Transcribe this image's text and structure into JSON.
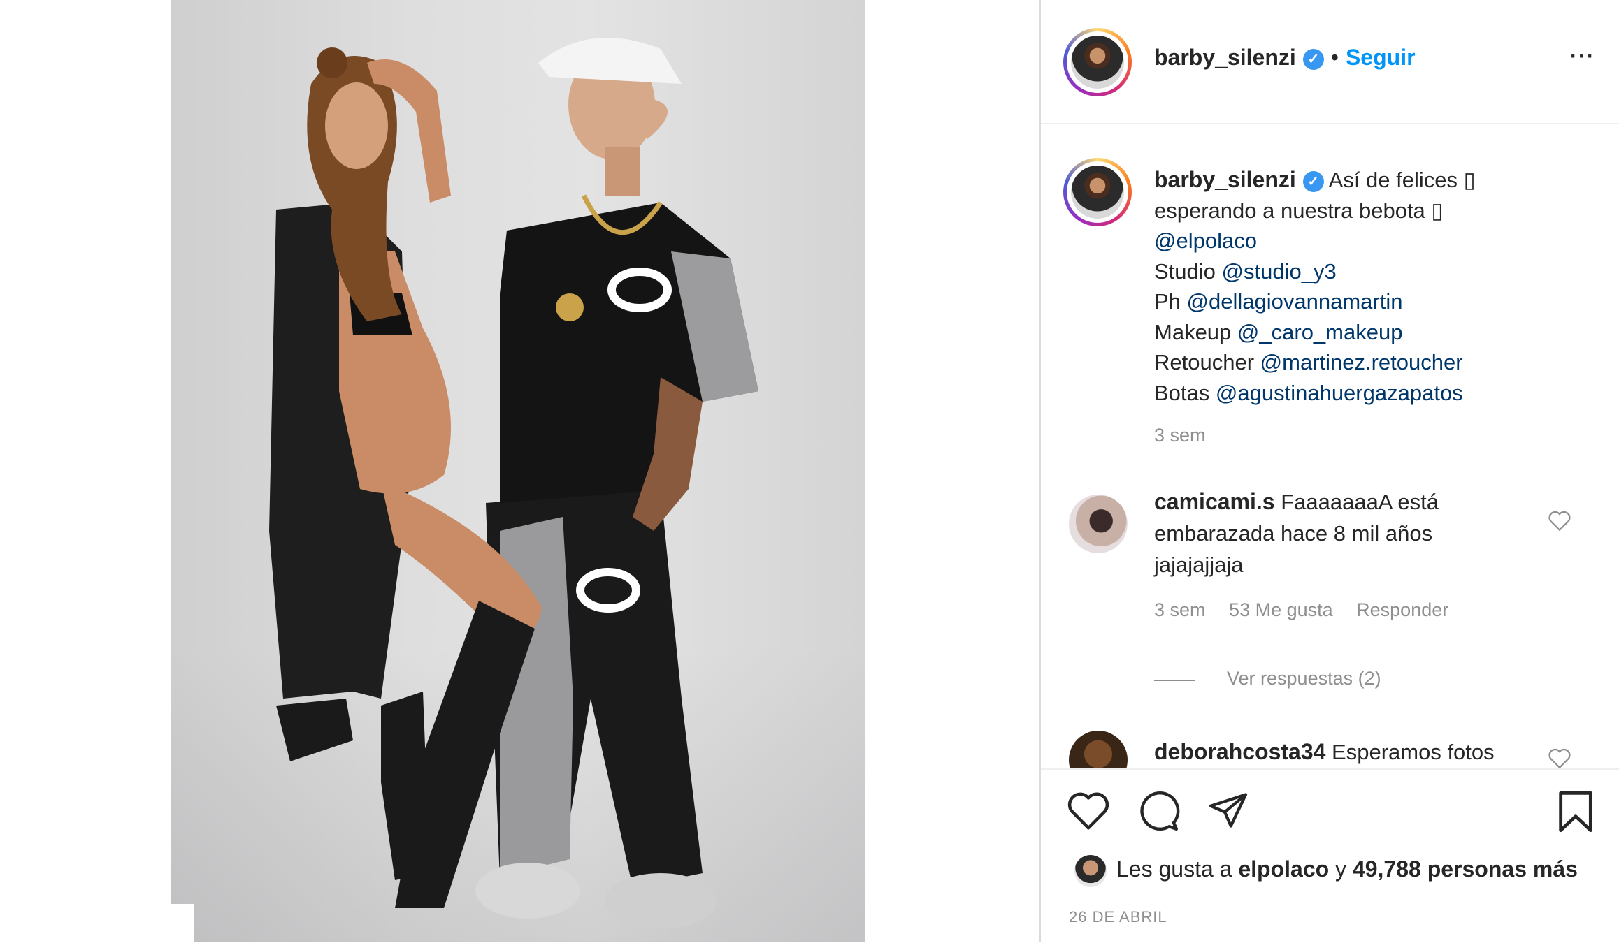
{
  "post_author": {
    "username": "barby_silenzi",
    "verified_glyph": "✓",
    "separator": "•",
    "follow_label": "Seguir",
    "more_icon": "more-options-icon"
  },
  "caption": {
    "username": "barby_silenzi",
    "line1": "Así de felices ▯",
    "line2": "esperando a nuestra bebota ▯",
    "mention1": "@elpolaco",
    "studio_label": "Studio",
    "studio_mention": "@studio_y3",
    "ph_label": "Ph",
    "ph_mention": "@dellagiovannamartin",
    "makeup_label": "Makeup",
    "makeup_mention": "@_caro_makeup",
    "retoucher_label": "Retoucher",
    "retoucher_mention": "@martinez.retoucher",
    "botas_label": "Botas",
    "botas_mention": "@agustinahuergazapatos",
    "time": "3 sem"
  },
  "comments": [
    {
      "username": "camicami.s",
      "text_line1": "FaaaaaaaA está",
      "text_line2": "embarazada hace 8 mil años",
      "text_line3": "jajajajjaja",
      "time": "3 sem",
      "likes": "53 Me gusta",
      "reply": "Responder",
      "view_replies": "Ver respuestas (2)"
    },
    {
      "username": "deborahcosta34",
      "text": "Esperamos fotos"
    }
  ],
  "likes": {
    "prefix": "Les gusta a",
    "user": "elpolaco",
    "connector": "y",
    "count": "49,788 personas más"
  },
  "date": "26 DE ABRIL",
  "colors": {
    "link": "#00376b",
    "follow": "#0095f6",
    "verified": "#3897f0",
    "meta": "#8e8e8e"
  }
}
